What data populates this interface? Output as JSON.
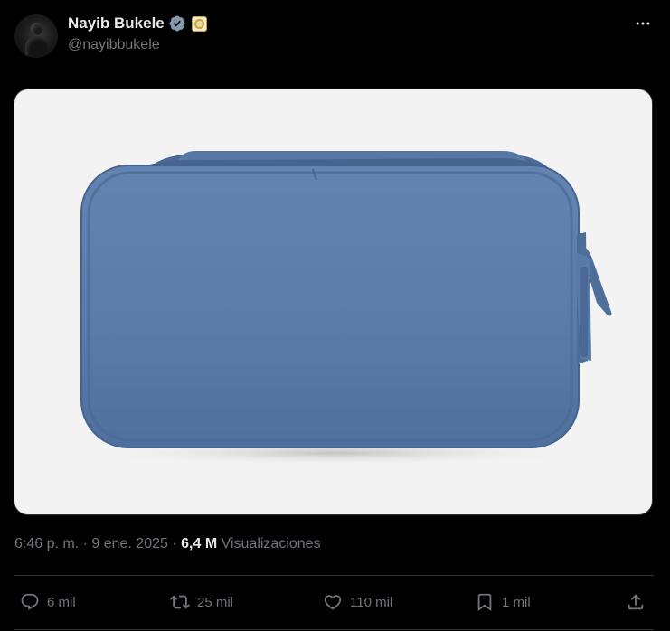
{
  "author": {
    "display_name": "Nayib Bukele",
    "handle": "@nayibbukele",
    "verified_icon": "verified-badge-icon",
    "affiliate_icon": "government-seal-icon"
  },
  "media": {
    "alt": "Estuche azul con cremallera"
  },
  "meta": {
    "time": "6:46 p. m.",
    "separator": " · ",
    "date": "9 ene. 2025",
    "views_count": "6,4 M",
    "views_label": " Visualizaciones"
  },
  "actions": {
    "reply": {
      "icon": "reply-icon",
      "count": "6 mil"
    },
    "repost": {
      "icon": "repost-icon",
      "count": "25 mil"
    },
    "like": {
      "icon": "heart-icon",
      "count": "110 mil"
    },
    "bookmark": {
      "icon": "bookmark-icon",
      "count": "1 mil"
    },
    "share": {
      "icon": "share-icon"
    }
  },
  "colors": {
    "background": "#000000",
    "text_primary": "#e7e9ea",
    "text_secondary": "#71767b",
    "verified": "#829aab",
    "divider": "#2f3336",
    "pouch": "#5b7ba8"
  }
}
